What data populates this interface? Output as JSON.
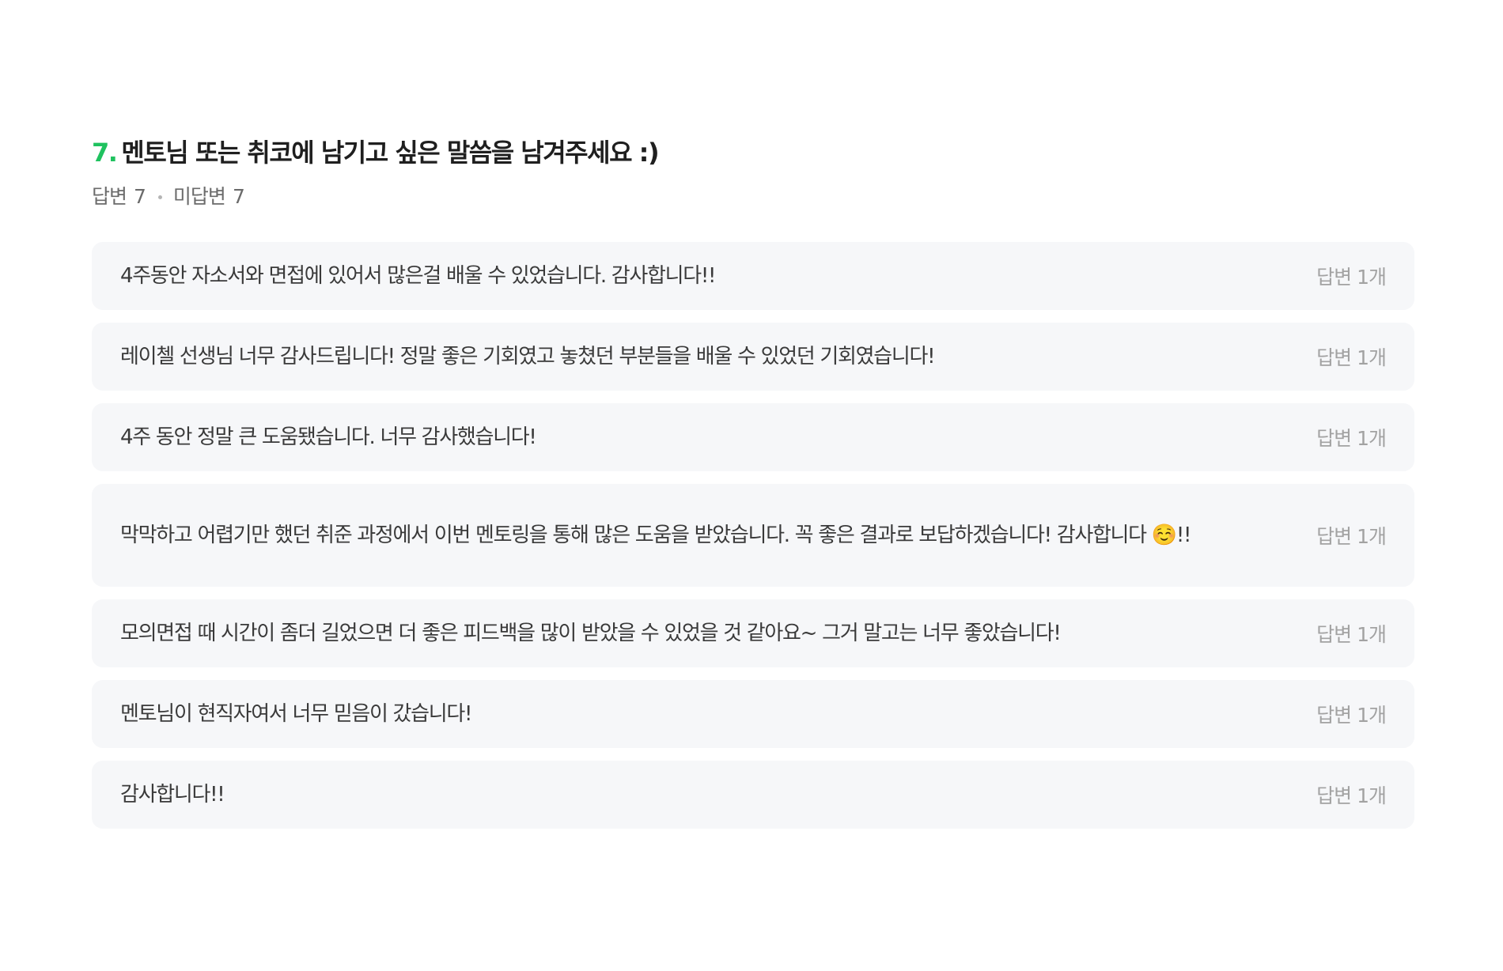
{
  "question": {
    "number": "7.",
    "title": "멘토님 또는 취코에 남기고 싶은 말씀을 남겨주세요 :)"
  },
  "stats": {
    "answered_label": "답변",
    "answered_count": "7",
    "unanswered_label": "미답변",
    "unanswered_count": "7"
  },
  "answers": [
    {
      "text": "4주동안 자소서와 면접에 있어서 많은걸 배울 수 있었습니다. 감사합니다!!",
      "count": "답변 1개"
    },
    {
      "text": "레이첼 선생님 너무 감사드립니다! 정말 좋은 기회였고 놓쳤던 부분들을 배울 수 있었던 기회였습니다!",
      "count": "답변 1개"
    },
    {
      "text": "4주 동안 정말 큰 도움됐습니다. 너무 감사했습니다!",
      "count": "답변 1개"
    },
    {
      "text": "막막하고 어렵기만 했던 취준 과정에서 이번 멘토링을 통해 많은 도움을 받았습니다. 꼭 좋은 결과로 보답하겠습니다! 감사합니다 ☺️!!",
      "count": "답변 1개"
    },
    {
      "text": "모의면접 때 시간이 좀더 길었으면 더 좋은 피드백을 많이 받았을 수 있었을 것 같아요~ 그거 말고는 너무 좋았습니다!",
      "count": "답변 1개"
    },
    {
      "text": "멘토님이 현직자여서 너무 믿음이 갔습니다!",
      "count": "답변 1개"
    },
    {
      "text": "감사합니다!!",
      "count": "답변 1개"
    }
  ]
}
